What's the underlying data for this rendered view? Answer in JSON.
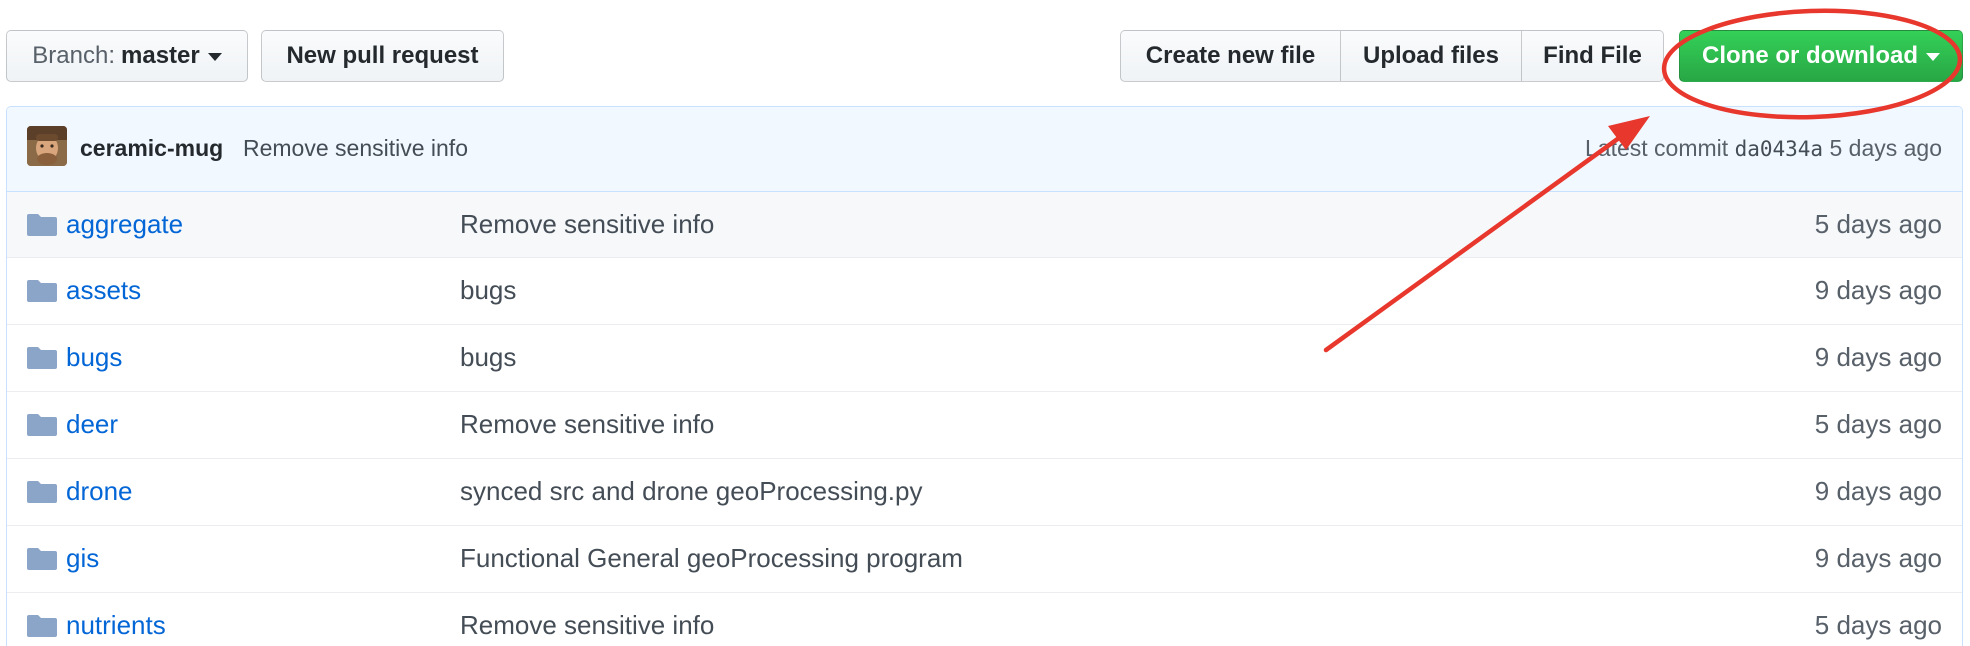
{
  "toolbar": {
    "branch_prefix": "Branch:",
    "branch_name": "master",
    "new_pr_label": "New pull request",
    "create_file_label": "Create new file",
    "upload_label": "Upload files",
    "find_file_label": "Find File",
    "clone_label": "Clone or download"
  },
  "commit": {
    "author": "ceramic-mug",
    "message": "Remove sensitive info",
    "latest_label": "Latest commit",
    "sha": "da0434a",
    "age": "5 days ago"
  },
  "files": [
    {
      "name": "aggregate",
      "message": "Remove sensitive info",
      "age": "5 days ago",
      "icon": "folder-icon"
    },
    {
      "name": "assets",
      "message": "bugs",
      "age": "9 days ago",
      "icon": "folder-icon"
    },
    {
      "name": "bugs",
      "message": "bugs",
      "age": "9 days ago",
      "icon": "folder-icon"
    },
    {
      "name": "deer",
      "message": "Remove sensitive info",
      "age": "5 days ago",
      "icon": "folder-icon"
    },
    {
      "name": "drone",
      "message": "synced src and drone geoProcessing.py",
      "age": "9 days ago",
      "icon": "folder-icon"
    },
    {
      "name": "gis",
      "message": "Functional General geoProcessing program",
      "age": "9 days ago",
      "icon": "folder-icon"
    },
    {
      "name": "nutrients",
      "message": "Remove sensitive info",
      "age": "5 days ago",
      "icon": "folder-icon"
    }
  ],
  "colors": {
    "clone_button": "#28a745",
    "link": "#0366d6",
    "annotation": "#e8372c",
    "commit_bar": "#f1f8ff",
    "folder": "#79b8ff"
  }
}
